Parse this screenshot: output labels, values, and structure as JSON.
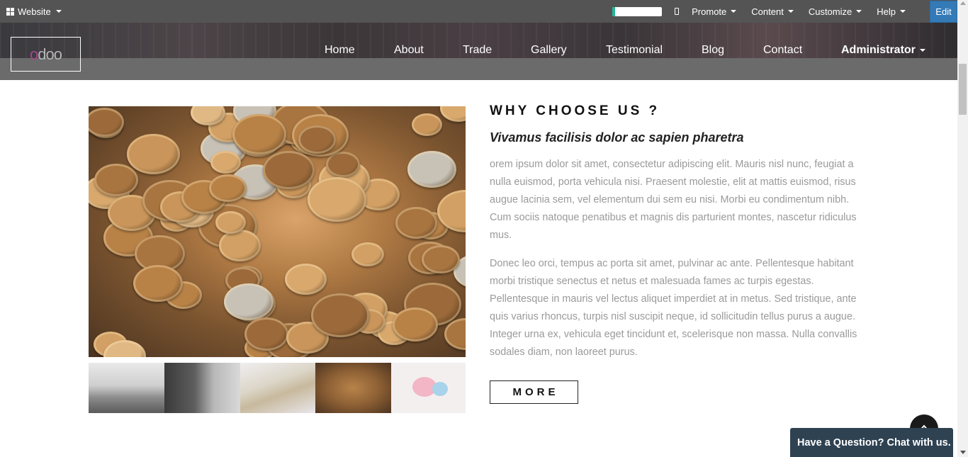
{
  "adminbar": {
    "website_label": "Website",
    "promote_label": "Promote",
    "content_label": "Content",
    "customize_label": "Customize",
    "help_label": "Help",
    "edit_label": "Edit",
    "progress_fraction": 0.05
  },
  "header": {
    "logo_text_first": "o",
    "logo_text_rest": "doo",
    "nav": {
      "home": "Home",
      "about": "About",
      "trade": "Trade",
      "gallery": "Gallery",
      "testimonial": "Testimonial",
      "blog": "Blog",
      "contact": "Contact",
      "admin": "Administrator"
    }
  },
  "section": {
    "title": "WHY CHOOSE US ?",
    "subtitle": "Vivamus facilisis dolor ac sapien pharetra",
    "paragraph1": "orem ipsum dolor sit amet, consectetur adipiscing elit. Mauris nisl nunc, feugiat a nulla euismod, porta vehicula nisi. Praesent molestie, elit at mattis euismod, risus augue lacinia sem, vel elementum dui sem eu nisi. Morbi eu condimentum nibh. Cum sociis natoque penatibus et magnis dis parturient montes, nascetur ridiculus mus.",
    "paragraph2": "Donec leo orci, tempus ac porta sit amet, pulvinar ac ante. Pellentesque habitant morbi tristique senectus et netus et malesuada fames ac turpis egestas. Pellentesque in mauris vel lectus aliquet imperdiet at in metus. Sed tristique, ante quis varius rhoncus, turpis nisl suscipit neque, id sollicitudin tellus purus a augue. Integer urna ex, vehicula eget tincidunt et, scelerisque non massa. Nulla convallis sodales diam, non laoreet purus.",
    "more_label": "MORE"
  },
  "chat": {
    "label": "Have a Question? Chat with us."
  },
  "colors": {
    "adminbar_bg": "#545454",
    "edit_bg": "#337ab7",
    "chat_bg": "#2f4252",
    "paragraph_text": "#9a9a9a",
    "progress_fill": "#21b799"
  }
}
